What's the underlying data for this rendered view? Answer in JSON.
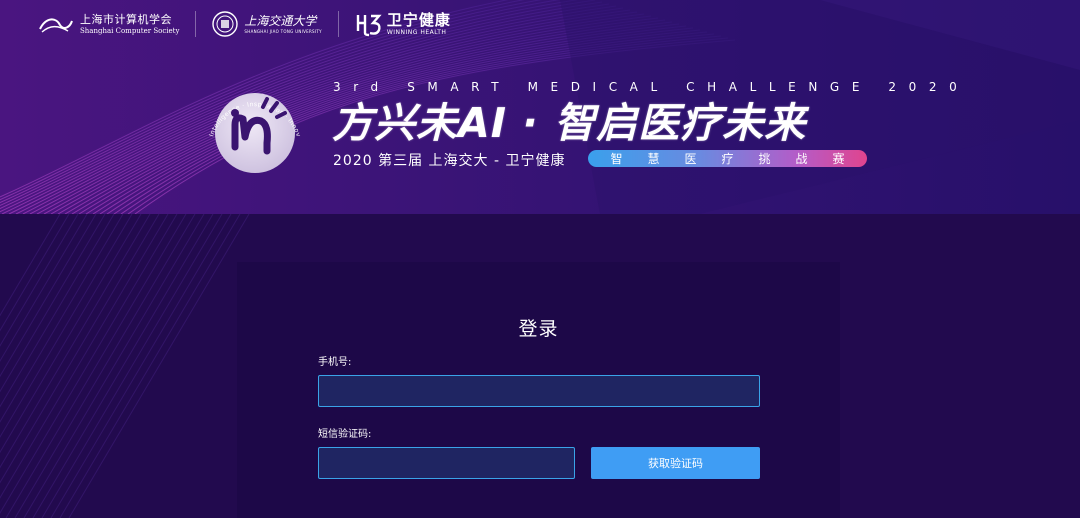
{
  "banner": {
    "logos": {
      "csc": {
        "name_cn": "上海市计算机学会",
        "name_en": "Shanghai Computer Society"
      },
      "sjtu": {
        "name_cn": "上海交通大学",
        "name_en": "SHANGHAI JIAO TONG UNIVERSITY"
      },
      "winning": {
        "name_cn": "卫宁健康",
        "name_en": "WINNING HEALTH"
      }
    },
    "emblem_ring_text": "Intelligence · Inspiration · Innovation",
    "subtitle_en": "3rd SMART MEDICAL CHALLENGE 2020",
    "main_title": "方兴未AI · 智启医疗未来",
    "edition": "2020 第三届 上海交大 - 卫宁健康",
    "challenge_label": "智慧医疗挑战赛",
    "colors": {
      "pill_start": "#3aa0ec",
      "pill_end": "#e0448e"
    }
  },
  "login": {
    "title": "登录",
    "phone_label": "手机号:",
    "phone_value": "",
    "sms_label": "短信验证码:",
    "sms_value": "",
    "get_code_label": "获取验证码"
  },
  "colors": {
    "background": "#220a4e",
    "panel": "#1d0848",
    "input_border": "#3aa3e8",
    "input_fill": "#1f2562",
    "button": "#3f9df4"
  }
}
